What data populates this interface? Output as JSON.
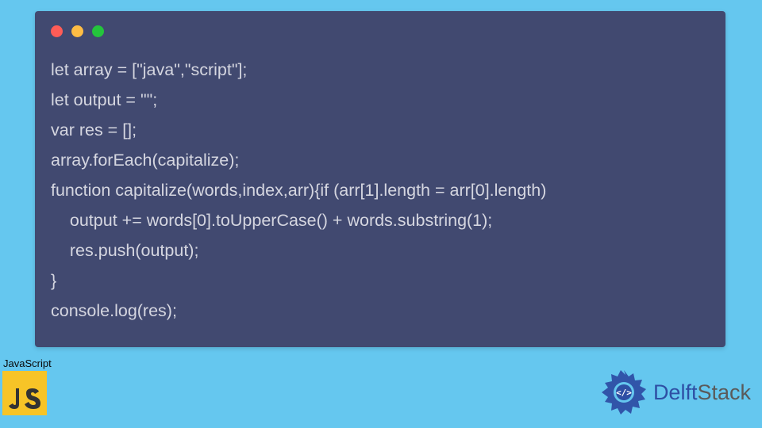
{
  "code_lines": [
    "let array = [\"java\",\"script\"];",
    "let output = \"\";",
    "var res = [];",
    "array.forEach(capitalize);",
    "function capitalize(words,index,arr){if (arr[1].length = arr[0].length)",
    "    output += words[0].toUpperCase() + words.substring(1);",
    "    res.push(output);",
    "}",
    "console.log(res);"
  ],
  "js_label": "JavaScript",
  "brand_first": "Delft",
  "brand_second": "Stack",
  "colors": {
    "bg": "#65c7ef",
    "window": "#414970",
    "code_text": "#d5d6e0",
    "js_yellow": "#f7c427",
    "brand_blue": "#2e4fa4"
  }
}
